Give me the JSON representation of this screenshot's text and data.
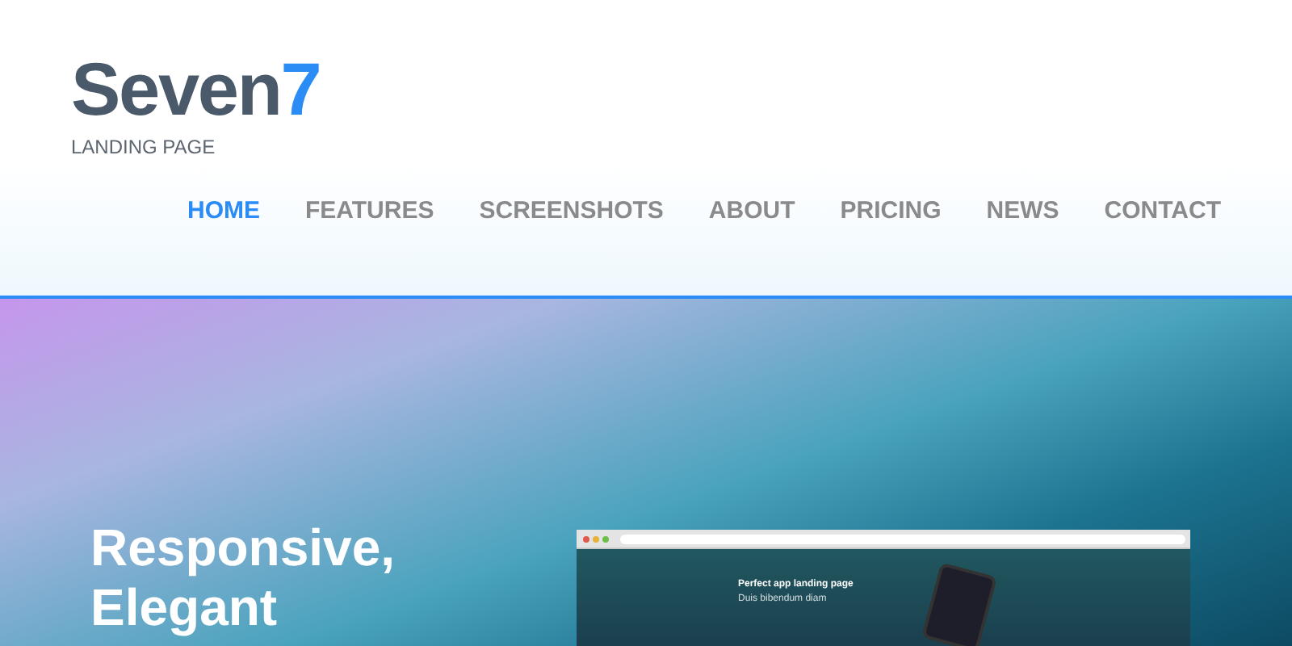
{
  "logo": {
    "name": "Seven",
    "mark": "7",
    "tagline": "LANDING PAGE"
  },
  "nav": [
    {
      "label": "HOME",
      "selected": true
    },
    {
      "label": "FEATURES",
      "selected": false
    },
    {
      "label": "SCREENSHOTS",
      "selected": false
    },
    {
      "label": "ABOUT",
      "selected": false
    },
    {
      "label": "PRICING",
      "selected": false
    },
    {
      "label": "NEWS",
      "selected": false
    },
    {
      "label": "CONTACT",
      "selected": false
    }
  ],
  "hero": {
    "heading_lines": [
      "Responsive,",
      "Elegant"
    ],
    "mockup": {
      "title": "Perfect app landing page",
      "subtitle": "Duis bibendum diam"
    }
  }
}
